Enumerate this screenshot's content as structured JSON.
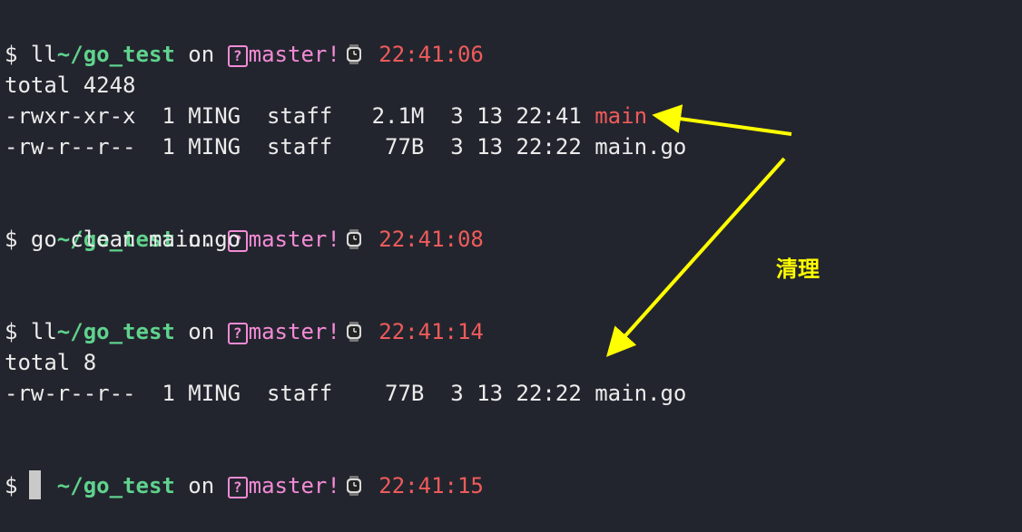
{
  "prompt_blocks": [
    {
      "dir": "~/go_test",
      "on": "on",
      "qmark": "?",
      "branch": "master!",
      "time": "22:41:06"
    },
    {
      "dir": "~/go_test",
      "on": "on",
      "qmark": "?",
      "branch": "master!",
      "time": "22:41:08"
    },
    {
      "dir": "~/go_test",
      "on": "on",
      "qmark": "?",
      "branch": "master!",
      "time": "22:41:14"
    },
    {
      "dir": "~/go_test",
      "on": "on",
      "qmark": "?",
      "branch": "master!",
      "time": "22:41:15"
    }
  ],
  "prompt_symbol": "$",
  "commands": [
    "ll",
    "go clean main.go",
    "ll"
  ],
  "output_1": {
    "total": "total 4248",
    "rows": [
      {
        "meta": "-rwxr-xr-x  1 MING  staff   2.1M  3 13 22:41 ",
        "name": "main"
      },
      {
        "meta": "-rw-r--r--  1 MING  staff    77B  3 13 22:22 ",
        "name": "main.go"
      }
    ]
  },
  "output_2": {
    "total": "total 8",
    "rows": [
      {
        "meta": "-rw-r--r--  1 MING  staff    77B  3 13 22:22 ",
        "name": "main.go"
      }
    ]
  },
  "annotation": {
    "label": "清理",
    "color": "#ffff00"
  },
  "colors": {
    "background": "#23252e",
    "dir": "#5fd38d",
    "branch": "#f38bd6",
    "time": "#ef5b5b",
    "executable": "#ef5b5b",
    "text": "#ececec"
  },
  "icons": {
    "clock": "watch-icon"
  }
}
